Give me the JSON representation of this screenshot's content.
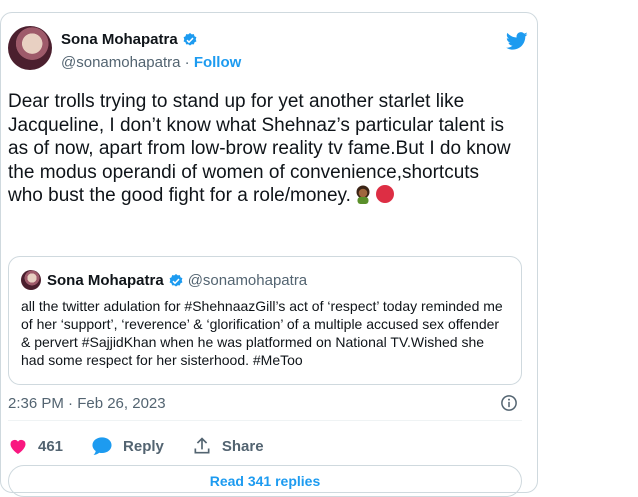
{
  "author": {
    "name": "Sona Mohapatra",
    "handle": "@sonamohapatra",
    "separator": "·",
    "follow_label": "Follow"
  },
  "tweet": {
    "text": "Dear trolls trying to stand up for yet another starlet like Jacqueline, I don’t know what Shehnaz’s particular talent is as of now, apart from low-brow reality tv fame.But I do know the modus operandi of women of convenience,shortcuts who bust the good fight for a role/money."
  },
  "quoted": {
    "name": "Sona Mohapatra",
    "handle": "@sonamohapatra",
    "text": "all the twitter adulation for #ShehnaazGill’s act of ‘respect’ today reminded me of her ‘support’, ‘reverence’ & ‘glorification’ of a multiple accused sex offender & pervert #SajjidKhan when he was platformed on National TV.Wished she had some respect for her sisterhood. #MeToo"
  },
  "timestamp": "2:36 PM · Feb 26, 2023",
  "actions": {
    "likes": "461",
    "reply_label": "Reply",
    "share_label": "Share"
  },
  "read_replies_label": "Read 341 replies",
  "colors": {
    "accent": "#1d9bf0",
    "like": "#f91880",
    "text": "#0f1419",
    "muted": "#536471"
  },
  "icons": [
    "verified-badge-icon",
    "twitter-bird-icon",
    "woman-emoji-icon",
    "red-circle-emoji-icon",
    "info-icon",
    "heart-icon",
    "reply-bubble-icon",
    "share-icon"
  ]
}
